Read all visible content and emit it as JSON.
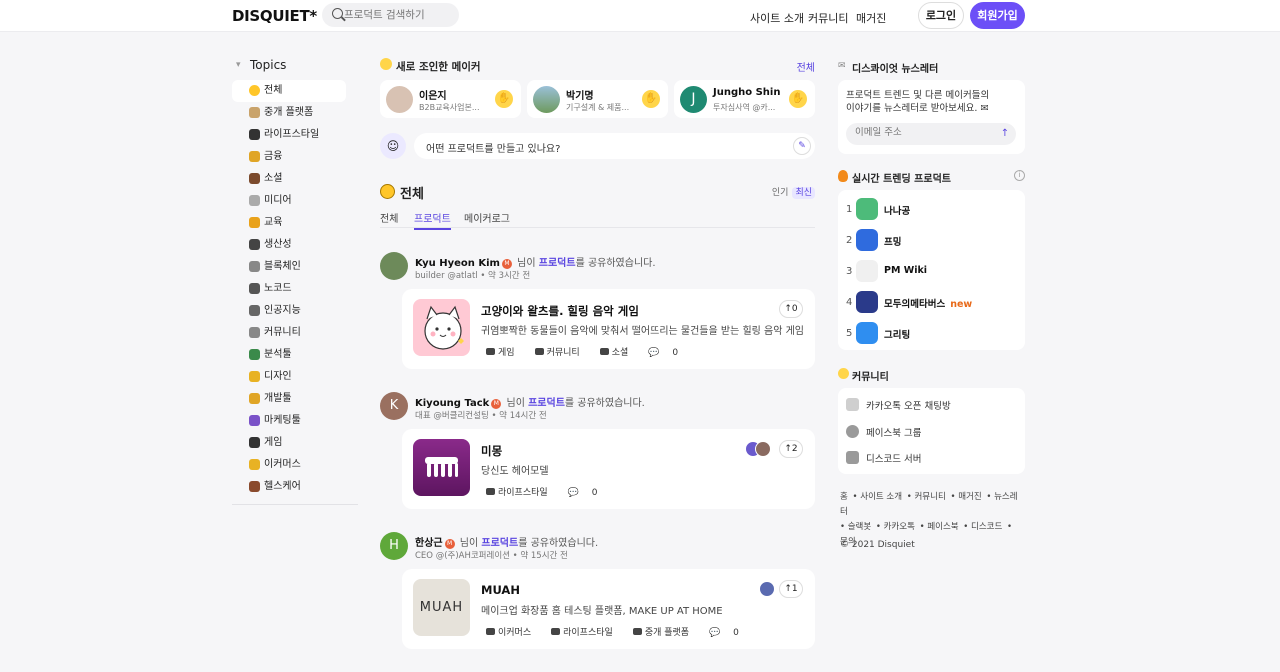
{
  "header": {
    "logo": "DISQUIET*",
    "search_placeholder": "프로덕트 검색하기",
    "nav": [
      "사이트 소개",
      "커뮤니티",
      "매거진"
    ],
    "login": "로그인",
    "signup": "회원가입",
    "accent": "#6c4ff7"
  },
  "topics": {
    "title": "Topics",
    "items": [
      {
        "label": "전체",
        "icon": "coin-icon",
        "color": "#ffc629"
      },
      {
        "label": "중개 플랫폼",
        "icon": "handshake-icon",
        "color": "#c9a36b"
      },
      {
        "label": "라이프스타일",
        "icon": "lifestyle-icon",
        "color": "#333"
      },
      {
        "label": "금융",
        "icon": "money-bag-icon",
        "color": "#e0a526"
      },
      {
        "label": "소셜",
        "icon": "people-icon",
        "color": "#7b4a2d"
      },
      {
        "label": "미디어",
        "icon": "mic-icon",
        "color": "#aaa"
      },
      {
        "label": "교육",
        "icon": "pencil-icon",
        "color": "#e9a21b"
      },
      {
        "label": "생산성",
        "icon": "bike-icon",
        "color": "#444"
      },
      {
        "label": "블록체인",
        "icon": "chain-icon",
        "color": "#888"
      },
      {
        "label": "노코드",
        "icon": "laptop-icon",
        "color": "#555"
      },
      {
        "label": "인공지능",
        "icon": "robot-icon",
        "color": "#666"
      },
      {
        "label": "커뮤니티",
        "icon": "keyboard-icon",
        "color": "#888"
      },
      {
        "label": "분석툴",
        "icon": "chart-icon",
        "color": "#3a8a4a"
      },
      {
        "label": "디자인",
        "icon": "palette-icon",
        "color": "#e8b224"
      },
      {
        "label": "개발툴",
        "icon": "developer-icon",
        "color": "#e0a526"
      },
      {
        "label": "마케팅툴",
        "icon": "megaphone-icon",
        "color": "#7a52c8"
      },
      {
        "label": "게임",
        "icon": "gamepad-icon",
        "color": "#333"
      },
      {
        "label": "이커머스",
        "icon": "card-icon",
        "color": "#e8b224"
      },
      {
        "label": "헬스케어",
        "icon": "runner-icon",
        "color": "#8a4a2d"
      }
    ]
  },
  "makers": {
    "title": "새로 조인한 메이커",
    "all": "전체",
    "list": [
      {
        "name": "이은지",
        "desc": "B2B교육사업본...",
        "avatar_color": "#d8c2b3"
      },
      {
        "name": "박기명",
        "desc": "기구설계 & 제품...",
        "avatar_color": "#8fb1c4"
      },
      {
        "name": "Jungho Shin",
        "desc": "투자심사역 @카...",
        "avatar_color": "#1f8a72",
        "initial": "J"
      }
    ]
  },
  "ask": {
    "placeholder": "어떤 프로덕트를 만들고 있나요?"
  },
  "feed": {
    "title": "전체",
    "sort_popular": "인기",
    "sort_latest": "최신",
    "tabs": [
      "전체",
      "프로덕트",
      "메이커로그"
    ]
  },
  "posts": [
    {
      "author": "Kyu Hyeon Kim",
      "badge": "M",
      "mid": "님이",
      "link": "프로덕트",
      "tail": "를 공유하였습니다.",
      "sub": "builder @atlatl • 약 3시간 전",
      "avatar_color": "#6d8a5a",
      "card": {
        "title": "고양이와 왈츠를. 힐링 음악 게임",
        "desc": "귀염뽀짝한 동물들이 음악에 맞춰서 떨어뜨리는 물건들을 받는 힐링 음악 게임",
        "tags": [
          "게임",
          "커뮤니티",
          "소셜"
        ],
        "comments": "0",
        "upvotes": "0",
        "thumb_color": "#ffc9d4"
      }
    },
    {
      "author": "Kiyoung Tack",
      "badge": "M",
      "mid": "님이",
      "link": "프로덕트",
      "tail": "를 공유하였습니다.",
      "sub": "대표 @버클리컨설팅 • 약 14시간 전",
      "avatar_color": "#9a7060",
      "initial": "K",
      "card": {
        "title": "미몽",
        "desc": "당신도 헤어모델",
        "tags": [
          "라이프스타일"
        ],
        "comments": "0",
        "upvotes": "2",
        "thumb_color": "#7a1f7a"
      }
    },
    {
      "author": "한상근",
      "badge": "M",
      "mid": "님이",
      "link": "프로덕트",
      "tail": "를 공유하였습니다.",
      "sub": "CEO @(주)AH코퍼레이션 • 약 15시간 전",
      "avatar_color": "#5fa83a",
      "initial": "H",
      "card": {
        "title": "MUAH",
        "desc": "메이크업 화장품 홈 테스팅 플랫폼, MAKE UP AT HOME",
        "tags": [
          "이커머스",
          "라이프스타일",
          "중개 플랫폼"
        ],
        "comments": "0",
        "upvotes": "1",
        "thumb_color": "#e6e2da",
        "thumb_text": "MUAH"
      }
    }
  ],
  "newsletter": {
    "title": "디스콰이엇 뉴스레터",
    "text1": "프로덕트 트렌드 및 다른 메이커들의",
    "text2": "이야기를 뉴스레터로 받아보세요.",
    "placeholder": "이메일 주소"
  },
  "trending": {
    "title": "실시간 트렌딩 프로덕트",
    "items": [
      {
        "rank": "1",
        "name": "나나공",
        "color": "#4dbb7a",
        "new": ""
      },
      {
        "rank": "2",
        "name": "프밍",
        "color": "#2f6bde",
        "new": ""
      },
      {
        "rank": "3",
        "name": "PM Wiki",
        "color": "#f0f0f0",
        "new": ""
      },
      {
        "rank": "4",
        "name": "모두의메타버스",
        "color": "#2a3a8a",
        "new": "new"
      },
      {
        "rank": "5",
        "name": "그리팅",
        "color": "#2f8ef0",
        "new": ""
      }
    ]
  },
  "community": {
    "title": "커뮤니티",
    "items": [
      "카카오톡 오픈 채팅방",
      "페이스북 그룹",
      "디스코드 서버"
    ]
  },
  "footer": {
    "line1": [
      "홈",
      "사이트 소개",
      "커뮤니티",
      "매거진",
      "뉴스레터"
    ],
    "line2": [
      "슬랙봇",
      "카카오톡",
      "페이스북",
      "디스코드"
    ],
    "line3": "문의",
    "copyright": "© 2021 Disquiet"
  }
}
